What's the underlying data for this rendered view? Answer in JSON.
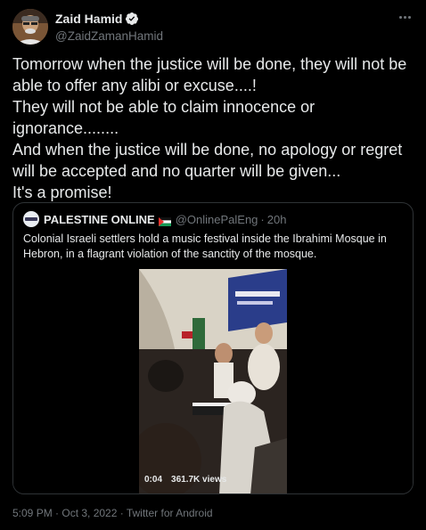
{
  "author": {
    "display_name": "Zaid Hamid",
    "handle": "@ZaidZamanHamid",
    "verified_icon": "verified-badge-icon",
    "more_icon": "more-horizontal-icon"
  },
  "tweet": {
    "text": "Tomorrow when the justice will be done, they will not be able to offer any alibi or excuse....!\nThey will not be able to claim innocence or ignorance........\nAnd when the justice will be done, no apology or regret will be accepted and no quarter will be given...\nIt's a promise!"
  },
  "quote": {
    "display_name": "PALESTINE ONLINE",
    "handle": "@OnlinePalEng",
    "separator": "·",
    "time": "20h",
    "text": "Colonial Israeli settlers hold a music festival inside the Ibrahimi Mosque in Hebron, in a flagrant violation of the sanctity of the mosque.",
    "video": {
      "duration": "0:04",
      "views": "361.7K views"
    }
  },
  "footer": {
    "timestamp": "5:09 PM · Oct 3, 2022 · Twitter for Android"
  },
  "colors": {
    "background": "#000000",
    "text": "#e7e9ea",
    "muted": "#71767b",
    "border": "#2f3336",
    "verified": "#1d9bf0"
  }
}
